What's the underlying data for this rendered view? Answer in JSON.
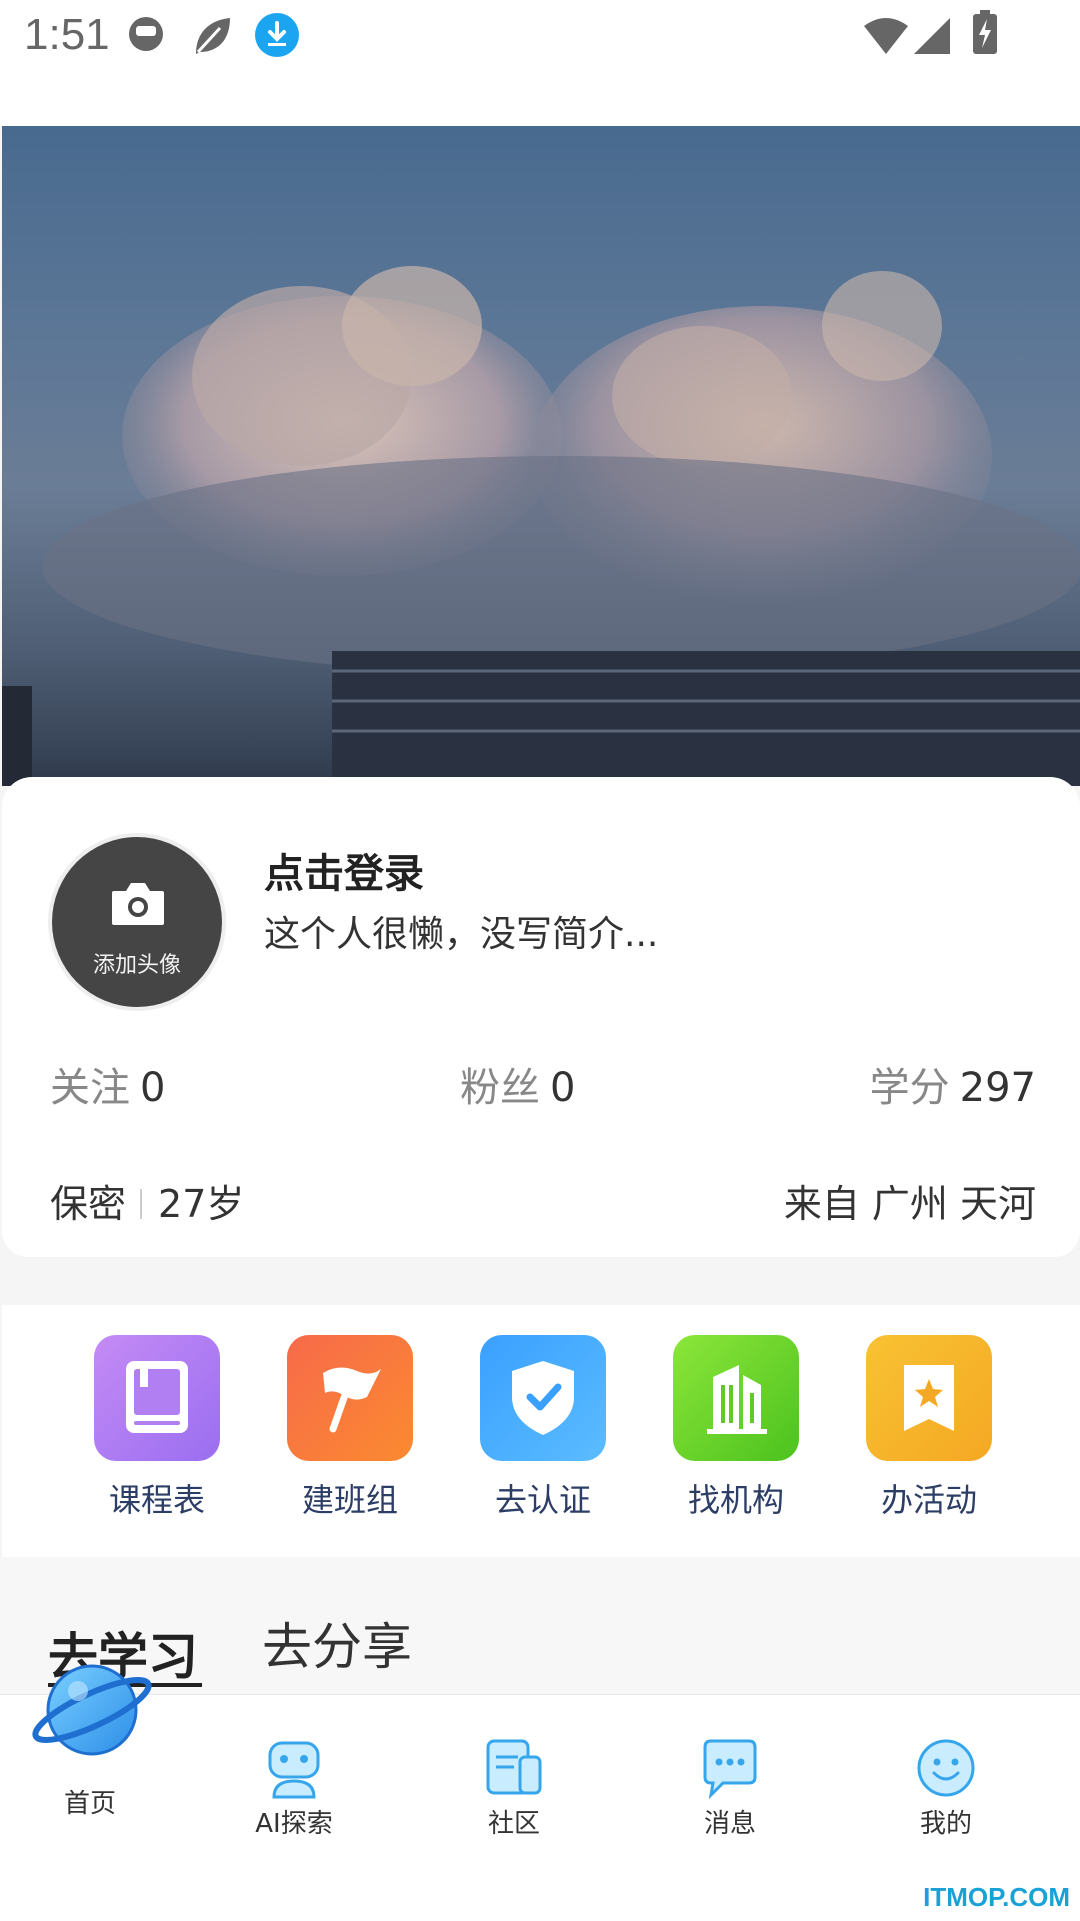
{
  "status_bar": {
    "time": "1:51",
    "icons": [
      "dnd-icon",
      "leaf-icon",
      "download-icon",
      "wifi-icon",
      "signal-icon",
      "battery-charging-icon"
    ]
  },
  "profile": {
    "avatar_label": "添加头像",
    "login_title": "点击登录",
    "bio": "这个人很懒，没写简介...",
    "stats": [
      {
        "label": "关注",
        "value": "0"
      },
      {
        "label": "粉丝",
        "value": "0"
      },
      {
        "label": "学分",
        "value": "297"
      }
    ],
    "gender": "保密",
    "age": "27岁",
    "location": "来自 广州 天河"
  },
  "actions": [
    {
      "label": "课程表",
      "icon": "book-icon",
      "color_from": "#c58bf5",
      "color_to": "#9a6ef0"
    },
    {
      "label": "建班组",
      "icon": "flag-icon",
      "color_from": "#f76a4a",
      "color_to": "#fb8a30"
    },
    {
      "label": "去认证",
      "icon": "shield-check-icon",
      "color_from": "#3aa0ff",
      "color_to": "#5bbcff"
    },
    {
      "label": "找机构",
      "icon": "building-icon",
      "color_from": "#8ce63a",
      "color_to": "#4cc21e"
    },
    {
      "label": "办活动",
      "icon": "bookmark-star-icon",
      "color_from": "#f8c233",
      "color_to": "#f5a823"
    }
  ],
  "tabs": {
    "learn": "去学习",
    "share": "去分享"
  },
  "bottom_nav": [
    {
      "label": "首页",
      "icon": "planet-icon"
    },
    {
      "label": "AI探索",
      "icon": "robot-icon"
    },
    {
      "label": "社区",
      "icon": "community-icon"
    },
    {
      "label": "消息",
      "icon": "chat-icon"
    },
    {
      "label": "我的",
      "icon": "smile-icon"
    }
  ],
  "watermark": "ITMOP.COM"
}
